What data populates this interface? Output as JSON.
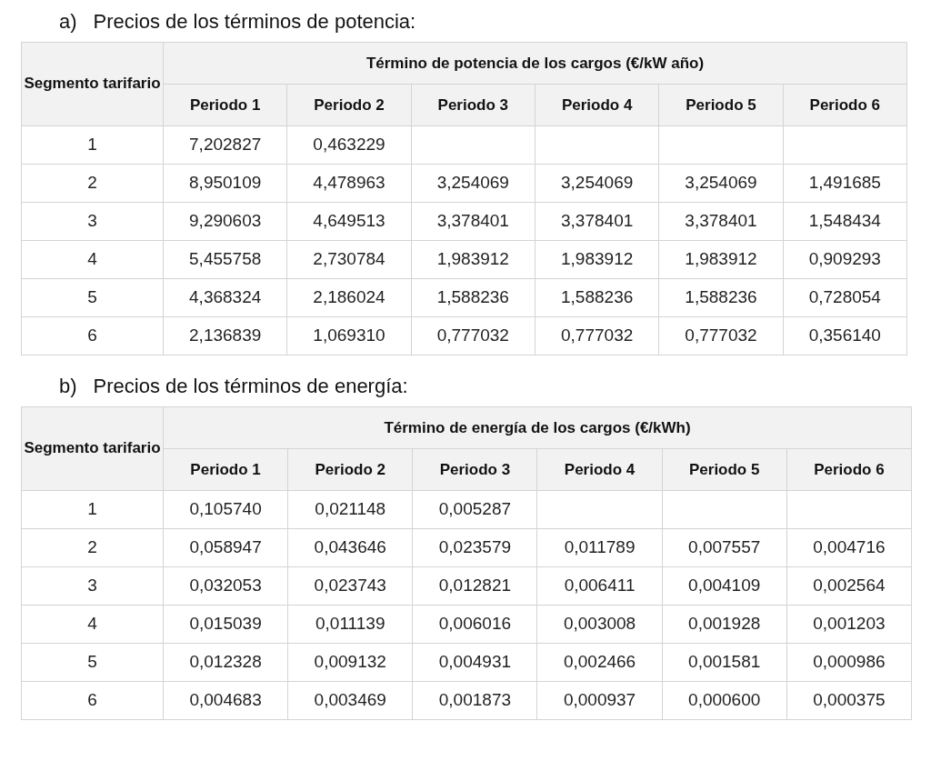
{
  "sections": [
    {
      "marker": "a)",
      "heading": "Precios de los términos de potencia:",
      "table": {
        "row_header": "Segmento tarifario",
        "group_header": "Término de potencia de los cargos (€/kW año)",
        "columns": [
          "Periodo 1",
          "Periodo 2",
          "Periodo 3",
          "Periodo 4",
          "Periodo 5",
          "Periodo 6"
        ],
        "rows": [
          {
            "segment": "1",
            "values": [
              "7,202827",
              "0,463229"
            ]
          },
          {
            "segment": "2",
            "values": [
              "8,950109",
              "4,478963",
              "3,254069",
              "3,254069",
              "3,254069",
              "1,491685"
            ]
          },
          {
            "segment": "3",
            "values": [
              "9,290603",
              "4,649513",
              "3,378401",
              "3,378401",
              "3,378401",
              "1,548434"
            ]
          },
          {
            "segment": "4",
            "values": [
              "5,455758",
              "2,730784",
              "1,983912",
              "1,983912",
              "1,983912",
              "0,909293"
            ]
          },
          {
            "segment": "5",
            "values": [
              "4,368324",
              "2,186024",
              "1,588236",
              "1,588236",
              "1,588236",
              "0,728054"
            ]
          },
          {
            "segment": "6",
            "values": [
              "2,136839",
              "1,069310",
              "0,777032",
              "0,777032",
              "0,777032",
              "0,356140"
            ]
          }
        ]
      }
    },
    {
      "marker": "b)",
      "heading": "Precios de los términos de energía:",
      "table": {
        "row_header": "Segmento tarifario",
        "group_header": "Término de energía de los cargos (€/kWh)",
        "columns": [
          "Periodo 1",
          "Periodo 2",
          "Periodo 3",
          "Periodo 4",
          "Periodo 5",
          "Periodo 6"
        ],
        "rows": [
          {
            "segment": "1",
            "values": [
              "0,105740",
              "0,021148",
              "0,005287"
            ]
          },
          {
            "segment": "2",
            "values": [
              "0,058947",
              "0,043646",
              "0,023579",
              "0,011789",
              "0,007557",
              "0,004716"
            ]
          },
          {
            "segment": "3",
            "values": [
              "0,032053",
              "0,023743",
              "0,012821",
              "0,006411",
              "0,004109",
              "0,002564"
            ]
          },
          {
            "segment": "4",
            "values": [
              "0,015039",
              "0,011139",
              "0,006016",
              "0,003008",
              "0,001928",
              "0,001203"
            ]
          },
          {
            "segment": "5",
            "values": [
              "0,012328",
              "0,009132",
              "0,004931",
              "0,002466",
              "0,001581",
              "0,000986"
            ]
          },
          {
            "segment": "6",
            "values": [
              "0,004683",
              "0,003469",
              "0,001873",
              "0,000937",
              "0,000600",
              "0,000375"
            ]
          }
        ]
      }
    }
  ]
}
